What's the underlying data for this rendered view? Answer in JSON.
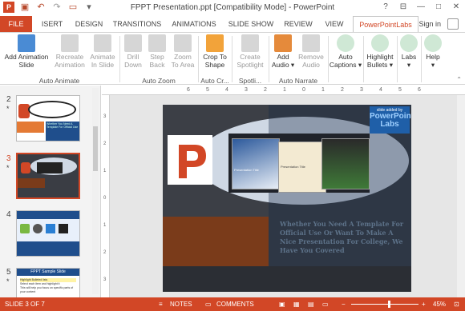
{
  "window": {
    "title": "FPPT Presentation.ppt [Compatibility Mode] - PowerPoint",
    "qat_icons": [
      "powerpoint-logo-icon",
      "save-icon",
      "undo-icon",
      "redo-icon",
      "slideshow-icon",
      "customize-icon"
    ],
    "controls": [
      "help-icon",
      "restore-ribbon-icon",
      "minimize-icon",
      "maximize-icon",
      "close-icon"
    ]
  },
  "tabs": [
    {
      "label": "FILE"
    },
    {
      "label": "ISERT"
    },
    {
      "label": "DESIGN"
    },
    {
      "label": "TRANSITIONS"
    },
    {
      "label": "ANIMATIONS"
    },
    {
      "label": "SLIDE SHOW"
    },
    {
      "label": "REVIEW"
    },
    {
      "label": "VIEW"
    },
    {
      "label": "PowerPointLabs"
    }
  ],
  "signin": "Sign in",
  "ribbon": {
    "buttons": [
      {
        "l1": "Add Animation",
        "l2": "Slide",
        "enabled": true
      },
      {
        "l1": "Recreate",
        "l2": "Animation",
        "enabled": false
      },
      {
        "l1": "Animate",
        "l2": "In Slide",
        "enabled": false
      },
      {
        "l1": "Drill",
        "l2": "Down",
        "enabled": false
      },
      {
        "l1": "Step",
        "l2": "Back",
        "enabled": false
      },
      {
        "l1": "Zoom",
        "l2": "To Area",
        "enabled": false
      },
      {
        "l1": "Crop To",
        "l2": "Shape",
        "enabled": true
      },
      {
        "l1": "Create",
        "l2": "Spotlight",
        "enabled": false
      },
      {
        "l1": "Add",
        "l2": "Audio ▾",
        "enabled": true
      },
      {
        "l1": "Remove",
        "l2": "Audio",
        "enabled": false
      },
      {
        "l1": "Auto",
        "l2": "Captions ▾",
        "enabled": true
      },
      {
        "l1": "Highlight",
        "l2": "Bullets ▾",
        "enabled": true
      },
      {
        "l1": "Labs",
        "l2": "▾",
        "enabled": true
      },
      {
        "l1": "Help",
        "l2": "▾",
        "enabled": true
      }
    ],
    "groups": [
      "Auto Animate",
      "Auto Zoom",
      "Auto Cr...",
      "Spotli...",
      "Auto Narrate"
    ]
  },
  "slides_pane": {
    "items": [
      {
        "number": "2",
        "star": "*"
      },
      {
        "number": "3",
        "star": "*"
      },
      {
        "number": "4",
        "star": ""
      },
      {
        "number": "5",
        "star": "*"
      }
    ],
    "thumb2_text": "Whether You Need A Template For Official Use",
    "thumb5_title": "FPPT Sample Slide",
    "thumb5_lines": [
      "Highlight Bulleted lists",
      "Select each item and highlight it",
      "This will help you focus on specific parts of your content"
    ]
  },
  "ruler": {
    "h_ticks": [
      "6",
      "5",
      "4",
      "3",
      "2",
      "1",
      "0",
      "1",
      "2",
      "3",
      "4",
      "5",
      "6"
    ],
    "v_ticks": [
      "3",
      "2",
      "1",
      "0",
      "1",
      "2",
      "3"
    ]
  },
  "slide": {
    "badge_small": "slide added by",
    "badge_big_1": "PowerPoint",
    "badge_big_2": "Labs",
    "card_title": "Presentation Title",
    "body_text": "Whether You Need A Template For Official Use Or Want To Make A Nice Presentation For College, We Have You Covered"
  },
  "statusbar": {
    "slide_info": "SLIDE 3 OF 7",
    "notes": "NOTES",
    "comments": "COMMENTS",
    "zoom_minus": "−",
    "zoom_plus": "+",
    "zoom": "45%",
    "zoom_fraction": 0.45
  },
  "colors": {
    "accent": "#d24726",
    "labs_blue": "#1f5fa8"
  }
}
